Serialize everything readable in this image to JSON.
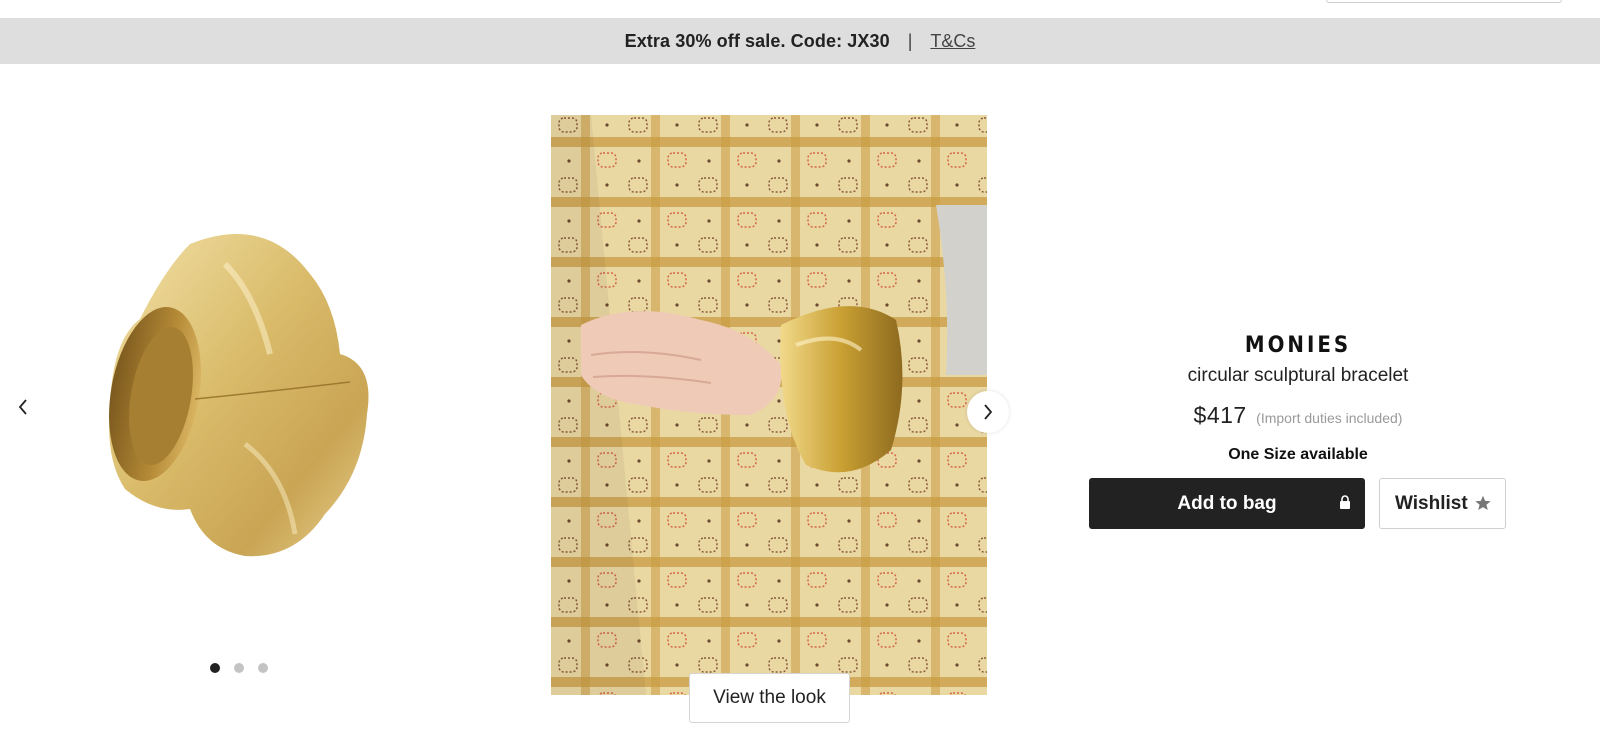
{
  "promo": {
    "text": "Extra 30% off sale. Code: JX30",
    "separator": "|",
    "terms_link": "T&Cs"
  },
  "gallery": {
    "dots_total": 3,
    "active_dot": 1,
    "view_look_label": "View the look"
  },
  "product": {
    "brand": "MONIES",
    "description": "circular sculptural bracelet",
    "price": "$417",
    "duties_note": "(Import duties included)",
    "size_availability": "One Size available"
  },
  "actions": {
    "add_to_bag_label": "Add to bag",
    "wishlist_label": "Wishlist"
  },
  "icons": {
    "prev": "chevron-left-icon",
    "next": "chevron-right-icon",
    "lock": "lock-icon",
    "star": "star-icon"
  },
  "colors": {
    "banner_bg": "#dedede",
    "primary_button": "#222222",
    "gold": "#d4b25a",
    "dress": "#e9d9a8"
  }
}
